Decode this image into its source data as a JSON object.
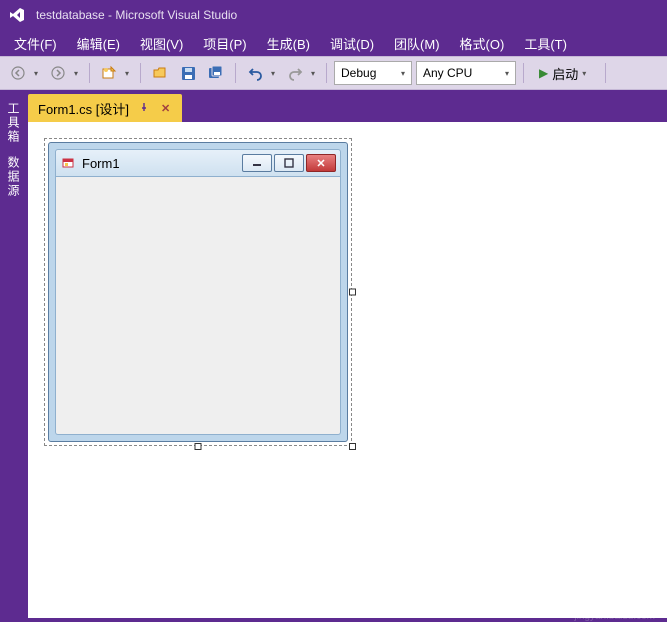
{
  "title": "testdatabase - Microsoft Visual Studio",
  "menu": {
    "items": [
      {
        "label": "文件(F)"
      },
      {
        "label": "编辑(E)"
      },
      {
        "label": "视图(V)"
      },
      {
        "label": "项目(P)"
      },
      {
        "label": "生成(B)"
      },
      {
        "label": "调试(D)"
      },
      {
        "label": "团队(M)"
      },
      {
        "label": "格式(O)"
      },
      {
        "label": "工具(T)"
      }
    ]
  },
  "toolbar": {
    "config_combo": "Debug",
    "platform_combo": "Any CPU",
    "run_label": "启动"
  },
  "side_tabs": {
    "items": [
      {
        "label": "工具箱"
      },
      {
        "label": "数据源"
      }
    ]
  },
  "doc_tabs": {
    "items": [
      {
        "label": "Form1.cs [设计]"
      }
    ]
  },
  "designer": {
    "form_title": "Form1"
  },
  "watermark": {
    "brand": "Baidu",
    "suffix": "经验",
    "url": "jingyan.baidu.com"
  }
}
